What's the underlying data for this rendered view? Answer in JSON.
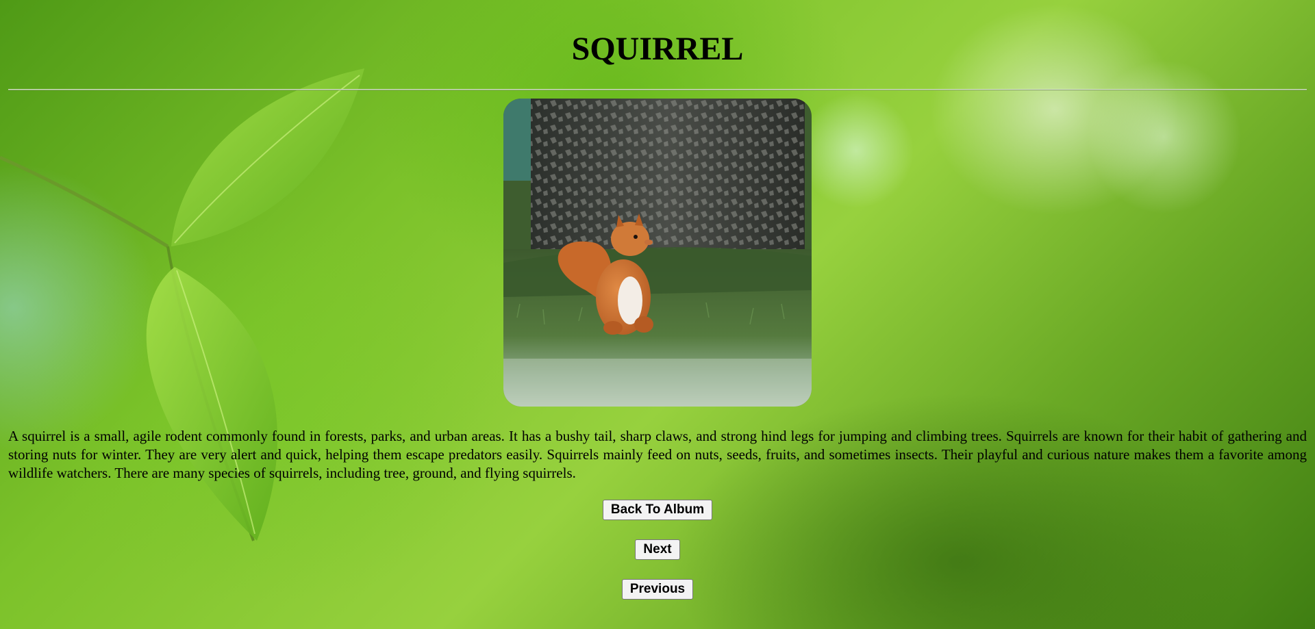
{
  "page": {
    "title": "SQUIRREL"
  },
  "photo": {
    "alt": "squirrel"
  },
  "description": "A squirrel is a small, agile rodent commonly found in forests, parks, and urban areas. It has a bushy tail, sharp claws, and strong hind legs for jumping and climbing trees. Squirrels are known for their habit of gathering and storing nuts for winter. They are very alert and quick, helping them escape predators easily. Squirrels mainly feed on nuts, seeds, fruits, and sometimes insects. Their playful and curious nature makes them a favorite among wildlife watchers. There are many species of squirrels, including tree, ground, and flying squirrels.",
  "buttons": {
    "back": "Back To Album",
    "next": "Next",
    "previous": "Previous"
  },
  "colors": {
    "background": "#7cc22a",
    "text": "#000000",
    "button_bg": "#f3f3f3"
  }
}
